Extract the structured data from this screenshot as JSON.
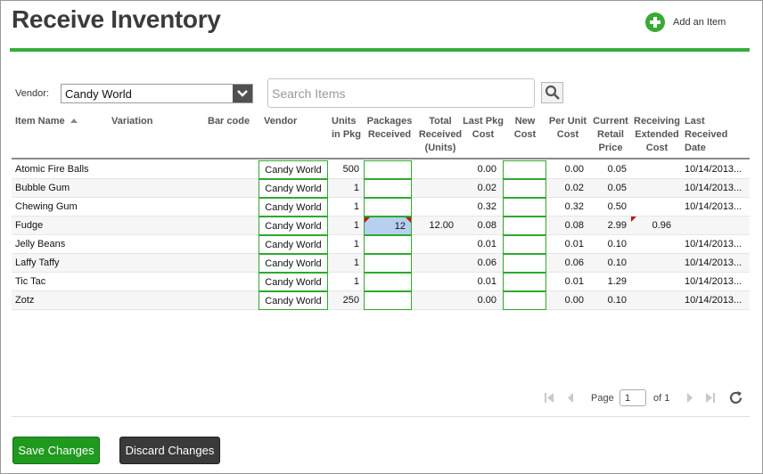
{
  "page": {
    "title": "Receive Inventory"
  },
  "add_item": {
    "label": "Add an Item",
    "icon": "plus-circle-icon",
    "color": "#3aa935"
  },
  "vendor_filter": {
    "label": "Vendor:",
    "value": "Candy World"
  },
  "search": {
    "placeholder": "Search Items",
    "icon": "search-icon"
  },
  "table": {
    "columns": {
      "item_name": "Item Name",
      "variation": "Variation",
      "barcode": "Bar code",
      "vendor": "Vendor",
      "units_in_pkg": "Units in Pkg",
      "packages_received": "Packages Received",
      "total_received": "Total Received (Units)",
      "last_pkg_cost": "Last Pkg Cost",
      "new_cost": "New Cost",
      "per_unit_cost": "Per Unit Cost",
      "current_retail_price": "Current Retail Price",
      "receiving_extended_cost": "Receiving Extended Cost",
      "last_received_date": "Last Received Date"
    },
    "rows": [
      {
        "item": "Atomic Fire Balls",
        "vendor": "Candy World",
        "units": "500",
        "packages": "",
        "total": "",
        "last_cost": "0.00",
        "new_cost": "",
        "per_unit": "0.00",
        "retail": "0.05",
        "extended": "",
        "date": "10/14/2013..."
      },
      {
        "item": "Bubble Gum",
        "vendor": "Candy World",
        "units": "1",
        "packages": "",
        "total": "",
        "last_cost": "0.02",
        "new_cost": "",
        "per_unit": "0.02",
        "retail": "0.05",
        "extended": "",
        "date": "10/14/2013..."
      },
      {
        "item": "Chewing Gum",
        "vendor": "Candy World",
        "units": "1",
        "packages": "",
        "total": "",
        "last_cost": "0.32",
        "new_cost": "",
        "per_unit": "0.32",
        "retail": "0.50",
        "extended": "",
        "date": "10/14/2013..."
      },
      {
        "item": "Fudge",
        "vendor": "Candy World",
        "units": "1",
        "packages": "12",
        "total": "12.00",
        "last_cost": "0.08",
        "new_cost": "",
        "per_unit": "0.08",
        "retail": "2.99",
        "extended": "0.96",
        "date": ""
      },
      {
        "item": "Jelly Beans",
        "vendor": "Candy World",
        "units": "1",
        "packages": "",
        "total": "",
        "last_cost": "0.01",
        "new_cost": "",
        "per_unit": "0.01",
        "retail": "0.10",
        "extended": "",
        "date": "10/14/2013..."
      },
      {
        "item": "Laffy Taffy",
        "vendor": "Candy World",
        "units": "1",
        "packages": "",
        "total": "",
        "last_cost": "0.06",
        "new_cost": "",
        "per_unit": "0.06",
        "retail": "0.10",
        "extended": "",
        "date": "10/14/2013..."
      },
      {
        "item": "Tic Tac",
        "vendor": "Candy World",
        "units": "1",
        "packages": "",
        "total": "",
        "last_cost": "0.01",
        "new_cost": "",
        "per_unit": "0.01",
        "retail": "1.29",
        "extended": "",
        "date": "10/14/2013..."
      },
      {
        "item": "Zotz",
        "vendor": "Candy World",
        "units": "250",
        "packages": "",
        "total": "",
        "last_cost": "0.00",
        "new_cost": "",
        "per_unit": "0.00",
        "retail": "0.10",
        "extended": "",
        "date": "10/14/2013..."
      }
    ]
  },
  "pagination": {
    "page_label": "Page",
    "current_page": "1",
    "of_label": "of 1"
  },
  "buttons": {
    "save": "Save Changes",
    "discard": "Discard Changes"
  },
  "colors": {
    "accent_green": "#36ad3a",
    "save_button": "#1f9a1f",
    "discard_button": "#3a3a3a",
    "edited_cell": "#b7cff0",
    "dirty_marker": "#cc1111"
  }
}
